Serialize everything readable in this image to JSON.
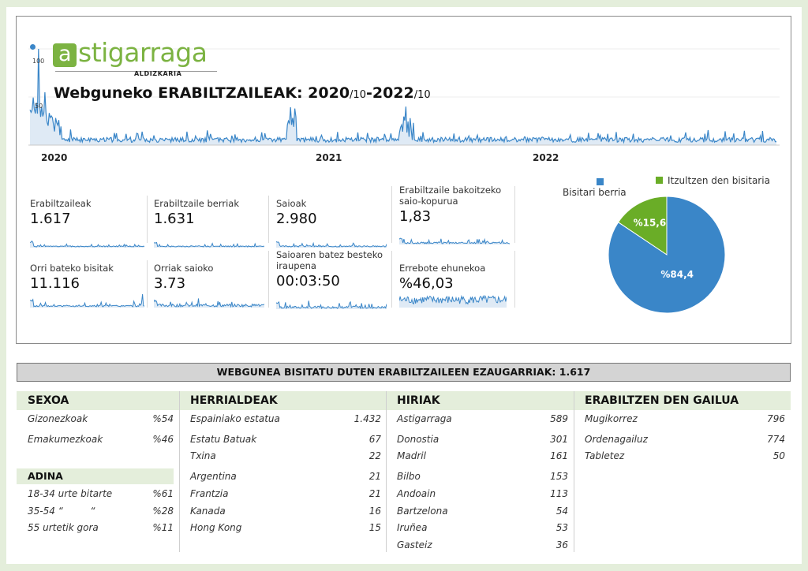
{
  "logo": {
    "name": "astigarraga",
    "subtitle": "ALDIZKARIA"
  },
  "title": {
    "main": "Webguneko ERABILTZAILEAK: 2020",
    "p1": "/10",
    "dash": "-",
    "main2": "2022",
    "p2": "/10"
  },
  "timeseries": {
    "y_ticks": [
      "100",
      "50"
    ],
    "years": [
      "2020",
      "2021",
      "2022"
    ],
    "color": "#3a86c8"
  },
  "kpis": [
    {
      "label": "Erabiltzaileak",
      "value": "1.617"
    },
    {
      "label": "Erabiltzaile berriak",
      "value": "1.631"
    },
    {
      "label": "Saioak",
      "value": "2.980"
    },
    {
      "label": "Erabiltzaile bakoitzeko saio-kopurua",
      "value": "1,83"
    },
    {
      "label": "Orri bateko bisitak",
      "value": "11.116"
    },
    {
      "label": "Orriak saioko",
      "value": "3.73"
    },
    {
      "label": "Saioaren batez besteko iraupena",
      "value": "00:03:50"
    },
    {
      "label": "Errebote ehunekoa",
      "value": "%46,03"
    }
  ],
  "chart_data": {
    "type": "pie",
    "series": [
      {
        "name": "Bisitari berria",
        "value": 84.4,
        "label": "%84,4",
        "color": "#3a86c8"
      },
      {
        "name": "Itzultzen den bisitaria",
        "value": 15.6,
        "label": "%15,6",
        "color": "#6aad27"
      }
    ]
  },
  "banner": "WEBGUNEA BISITATU DUTEN ERABILTZAILEEN EZAUGARRIAK: 1.617",
  "sexoa": {
    "title": "SEXOA",
    "rows": [
      {
        "label": "Gizonezkoak",
        "value": "%54"
      },
      {
        "label": "Emakumezkoak",
        "value": "%46"
      }
    ]
  },
  "adina": {
    "title": "ADINA",
    "rows": [
      {
        "label": "18-34 urte bitarte",
        "value": "%61"
      },
      {
        "label": "35-54 “         “",
        "value": "%28"
      },
      {
        "label": "55 urtetik gora",
        "value": "%11"
      }
    ]
  },
  "herrialdeak": {
    "title": "HERRIALDEAK",
    "rows": [
      {
        "label": "Espainiako estatua",
        "value": "1.432"
      },
      {
        "label": "Estatu Batuak",
        "value": "67"
      },
      {
        "label": "Txina",
        "value": "22"
      },
      {
        "label": "Argentina",
        "value": "21"
      },
      {
        "label": "Frantzia",
        "value": "21"
      },
      {
        "label": "Kanada",
        "value": "16"
      },
      {
        "label": "Hong Kong",
        "value": "15"
      }
    ]
  },
  "hiriak": {
    "title": "HIRIAK",
    "rows": [
      {
        "label": "Astigarraga",
        "value": "589"
      },
      {
        "label": "Donostia",
        "value": "301"
      },
      {
        "label": "Madril",
        "value": "161"
      },
      {
        "label": "Bilbo",
        "value": "153"
      },
      {
        "label": "Andoain",
        "value": "113"
      },
      {
        "label": "Bartzelona",
        "value": "54"
      },
      {
        "label": "Iruñea",
        "value": "53"
      },
      {
        "label": "Gasteiz",
        "value": "36"
      }
    ]
  },
  "gailua": {
    "title": "ERABILTZEN DEN GAILUA",
    "rows": [
      {
        "label": "Mugikorrez",
        "value": "796"
      },
      {
        "label": "Ordenagailuz",
        "value": "774"
      },
      {
        "label": "Tabletez",
        "value": "50"
      }
    ]
  }
}
